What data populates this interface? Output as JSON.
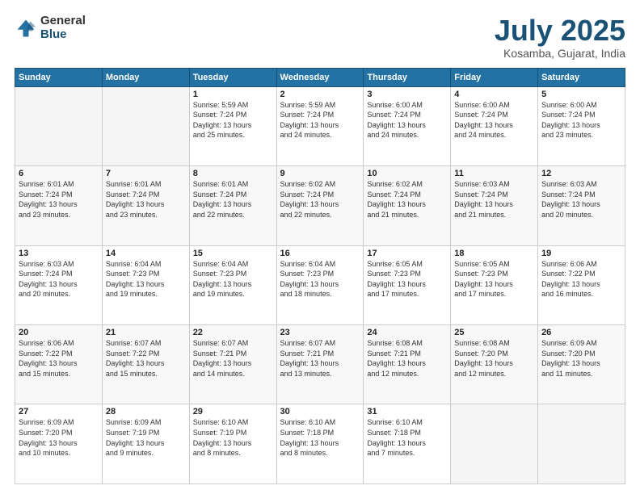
{
  "header": {
    "logo_general": "General",
    "logo_blue": "Blue",
    "month_title": "July 2025",
    "location": "Kosamba, Gujarat, India"
  },
  "weekdays": [
    "Sunday",
    "Monday",
    "Tuesday",
    "Wednesday",
    "Thursday",
    "Friday",
    "Saturday"
  ],
  "weeks": [
    [
      {
        "day": "",
        "info": ""
      },
      {
        "day": "",
        "info": ""
      },
      {
        "day": "1",
        "info": "Sunrise: 5:59 AM\nSunset: 7:24 PM\nDaylight: 13 hours\nand 25 minutes."
      },
      {
        "day": "2",
        "info": "Sunrise: 5:59 AM\nSunset: 7:24 PM\nDaylight: 13 hours\nand 24 minutes."
      },
      {
        "day": "3",
        "info": "Sunrise: 6:00 AM\nSunset: 7:24 PM\nDaylight: 13 hours\nand 24 minutes."
      },
      {
        "day": "4",
        "info": "Sunrise: 6:00 AM\nSunset: 7:24 PM\nDaylight: 13 hours\nand 24 minutes."
      },
      {
        "day": "5",
        "info": "Sunrise: 6:00 AM\nSunset: 7:24 PM\nDaylight: 13 hours\nand 23 minutes."
      }
    ],
    [
      {
        "day": "6",
        "info": "Sunrise: 6:01 AM\nSunset: 7:24 PM\nDaylight: 13 hours\nand 23 minutes."
      },
      {
        "day": "7",
        "info": "Sunrise: 6:01 AM\nSunset: 7:24 PM\nDaylight: 13 hours\nand 23 minutes."
      },
      {
        "day": "8",
        "info": "Sunrise: 6:01 AM\nSunset: 7:24 PM\nDaylight: 13 hours\nand 22 minutes."
      },
      {
        "day": "9",
        "info": "Sunrise: 6:02 AM\nSunset: 7:24 PM\nDaylight: 13 hours\nand 22 minutes."
      },
      {
        "day": "10",
        "info": "Sunrise: 6:02 AM\nSunset: 7:24 PM\nDaylight: 13 hours\nand 21 minutes."
      },
      {
        "day": "11",
        "info": "Sunrise: 6:03 AM\nSunset: 7:24 PM\nDaylight: 13 hours\nand 21 minutes."
      },
      {
        "day": "12",
        "info": "Sunrise: 6:03 AM\nSunset: 7:24 PM\nDaylight: 13 hours\nand 20 minutes."
      }
    ],
    [
      {
        "day": "13",
        "info": "Sunrise: 6:03 AM\nSunset: 7:24 PM\nDaylight: 13 hours\nand 20 minutes."
      },
      {
        "day": "14",
        "info": "Sunrise: 6:04 AM\nSunset: 7:23 PM\nDaylight: 13 hours\nand 19 minutes."
      },
      {
        "day": "15",
        "info": "Sunrise: 6:04 AM\nSunset: 7:23 PM\nDaylight: 13 hours\nand 19 minutes."
      },
      {
        "day": "16",
        "info": "Sunrise: 6:04 AM\nSunset: 7:23 PM\nDaylight: 13 hours\nand 18 minutes."
      },
      {
        "day": "17",
        "info": "Sunrise: 6:05 AM\nSunset: 7:23 PM\nDaylight: 13 hours\nand 17 minutes."
      },
      {
        "day": "18",
        "info": "Sunrise: 6:05 AM\nSunset: 7:23 PM\nDaylight: 13 hours\nand 17 minutes."
      },
      {
        "day": "19",
        "info": "Sunrise: 6:06 AM\nSunset: 7:22 PM\nDaylight: 13 hours\nand 16 minutes."
      }
    ],
    [
      {
        "day": "20",
        "info": "Sunrise: 6:06 AM\nSunset: 7:22 PM\nDaylight: 13 hours\nand 15 minutes."
      },
      {
        "day": "21",
        "info": "Sunrise: 6:07 AM\nSunset: 7:22 PM\nDaylight: 13 hours\nand 15 minutes."
      },
      {
        "day": "22",
        "info": "Sunrise: 6:07 AM\nSunset: 7:21 PM\nDaylight: 13 hours\nand 14 minutes."
      },
      {
        "day": "23",
        "info": "Sunrise: 6:07 AM\nSunset: 7:21 PM\nDaylight: 13 hours\nand 13 minutes."
      },
      {
        "day": "24",
        "info": "Sunrise: 6:08 AM\nSunset: 7:21 PM\nDaylight: 13 hours\nand 12 minutes."
      },
      {
        "day": "25",
        "info": "Sunrise: 6:08 AM\nSunset: 7:20 PM\nDaylight: 13 hours\nand 12 minutes."
      },
      {
        "day": "26",
        "info": "Sunrise: 6:09 AM\nSunset: 7:20 PM\nDaylight: 13 hours\nand 11 minutes."
      }
    ],
    [
      {
        "day": "27",
        "info": "Sunrise: 6:09 AM\nSunset: 7:20 PM\nDaylight: 13 hours\nand 10 minutes."
      },
      {
        "day": "28",
        "info": "Sunrise: 6:09 AM\nSunset: 7:19 PM\nDaylight: 13 hours\nand 9 minutes."
      },
      {
        "day": "29",
        "info": "Sunrise: 6:10 AM\nSunset: 7:19 PM\nDaylight: 13 hours\nand 8 minutes."
      },
      {
        "day": "30",
        "info": "Sunrise: 6:10 AM\nSunset: 7:18 PM\nDaylight: 13 hours\nand 8 minutes."
      },
      {
        "day": "31",
        "info": "Sunrise: 6:10 AM\nSunset: 7:18 PM\nDaylight: 13 hours\nand 7 minutes."
      },
      {
        "day": "",
        "info": ""
      },
      {
        "day": "",
        "info": ""
      }
    ]
  ]
}
